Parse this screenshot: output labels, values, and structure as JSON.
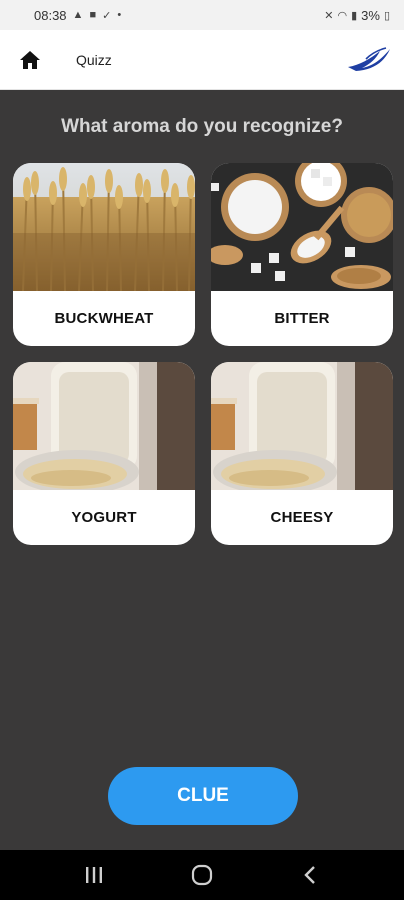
{
  "status_bar": {
    "time": "08:38",
    "dot": "•",
    "battery": "3%"
  },
  "app_bar": {
    "title": "Quizz",
    "home_icon": "home-icon",
    "logo_icon": "bird-logo-icon"
  },
  "question": "What aroma do you recognize?",
  "options": [
    {
      "label": "BUCKWHEAT",
      "image": "wheat-field-photo"
    },
    {
      "label": "BITTER",
      "image": "sugar-bowls-photo"
    },
    {
      "label": "YOGURT",
      "image": "yogurt-jar-photo"
    },
    {
      "label": "CHEESY",
      "image": "yogurt-jar-photo"
    }
  ],
  "clue_button": "CLUE",
  "colors": {
    "background": "#3a3939",
    "accent": "#2d9af0",
    "card": "#ffffff"
  }
}
